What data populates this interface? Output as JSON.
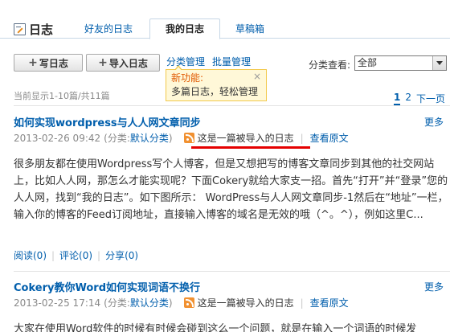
{
  "header": {
    "title": "日志",
    "tabs": [
      "好友的日志",
      "我的日志",
      "草稿箱"
    ],
    "active_tab": "我的日志"
  },
  "toolbar": {
    "write_label": "写日志",
    "import_label": "导入日志",
    "category_manage": "分类管理",
    "batch_manage": "批量管理",
    "filter_label": "分类查看:",
    "filter_value": "全部"
  },
  "tooltip": {
    "title": "新功能:",
    "body": "多篇日志，轻松管理",
    "close": "×"
  },
  "list": {
    "count_text": "当前显示1-10篇/共11篇",
    "pager": [
      "1",
      "2",
      "下一页"
    ],
    "current_page": "1"
  },
  "posts": [
    {
      "title": "如何实现wordpress与人人网文章同步",
      "more": "更多",
      "date": "2013-02-26 09:42",
      "category_prefix": "(分类:",
      "category": "默认分类",
      "category_suffix": ")",
      "imported": "这是一篇被导入的日志",
      "view_original": "查看原文",
      "body": "很多朋友都在使用Wordpress写个人博客，但是又想把写的博客文章同步到其他的社交网站上，比如人人网，那怎么才能实现呢？下面Cokery就给大家支一招。首先“打开”并“登录”您的人人网，找到“我的日志”。如下图所示： WordPress与人人网文章同步-1然后在“地址”一栏，输入你的博客的Feed订阅地址，直接输入博客的域名是无效的哦（^。^），例如这里C...",
      "read": "阅读(0)",
      "comment": "评论(0)",
      "share": "分享(0)"
    },
    {
      "title": "Cokery教你Word如何实现词语不换行",
      "more": "更多",
      "date": "2013-02-25 17:14",
      "category_prefix": "(分类:",
      "category": "默认分类",
      "category_suffix": ")",
      "imported": "这是一篇被导入的日志",
      "view_original": "查看原文",
      "body": "大家在使用Word软件的时候有时候会碰到这么一个问题，就是在输入一个词语的时候发"
    }
  ],
  "colors": {
    "link": "#005eac",
    "highlight_underline": "#e50000",
    "new_feature": "#e05800",
    "rss": "#f19131"
  }
}
